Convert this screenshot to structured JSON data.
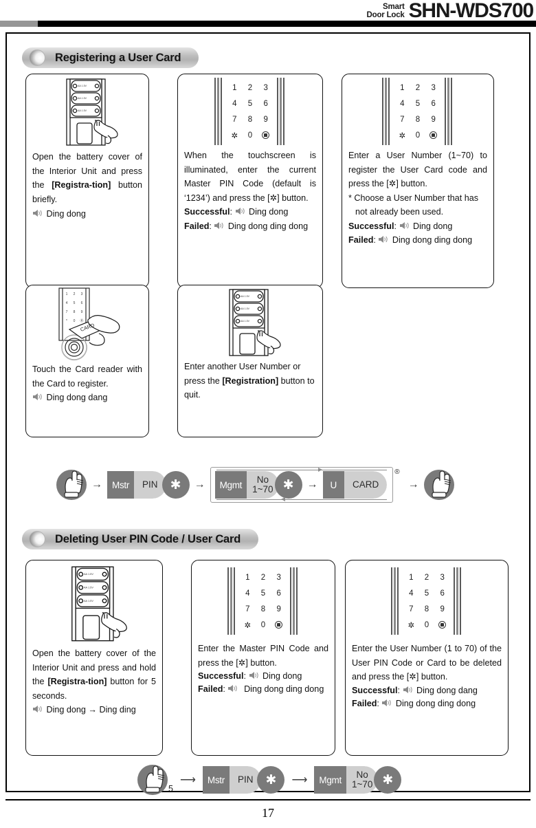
{
  "header": {
    "brand_line1": "Smart",
    "brand_line2": "Door Lock",
    "model": "SHN-WDS700"
  },
  "sections": [
    {
      "title": "Registering a User Card",
      "cards": [
        {
          "art": "battery-cover-press",
          "lines": [
            {
              "t": "Open the battery cover of the Interior Unit and press the ",
              "b": "[Registra-tion]",
              "t2": " button briefly."
            }
          ],
          "sound": "Ding dong"
        },
        {
          "art": "keypad",
          "body": "When the touchscreen is illuminated, enter the current Master PIN Code (default is ‘1234’) and press the [✲] button.",
          "success_label": "Successful",
          "success_sound": "Ding dong",
          "failed_label": "Failed",
          "failed_sound": "Ding dong ding dong"
        },
        {
          "art": "keypad",
          "body": "Enter a User Number (1~70) to register the User Card code and press the [✲] button.",
          "note": "* Choose a User Number that has not already been used.",
          "success_label": "Successful",
          "success_sound": "Ding dong",
          "failed_label": "Failed",
          "failed_sound": "Ding dong ding dong"
        },
        {
          "art": "card-reader",
          "body": "Touch the Card reader with the Card to register.",
          "sound": "Ding dong dang"
        },
        {
          "art": "battery-cover-press",
          "body_pre": "Enter another User Number or press the ",
          "body_bold": "[Registration]",
          "body_post": " button  to quit."
        }
      ],
      "flow": {
        "hand": "hand-press-icon",
        "arrow": "→",
        "steps": [
          {
            "left": "Mstr",
            "right": "PIN"
          },
          {
            "star": "✱"
          },
          {
            "group": [
              {
                "left": "Mgmt",
                "right": "No\n1~70"
              },
              {
                "star": "✱"
              },
              {
                "arrow": "→"
              },
              {
                "left": "U",
                "right": "CARD"
              }
            ],
            "reg": "®"
          },
          {
            "hand": "hand-press-icon"
          }
        ]
      }
    },
    {
      "title": "Deleting User PIN Code / User Card",
      "cards": [
        {
          "art": "battery-cover-press",
          "body_pre": "Open the battery cover of the Interior Unit and press and hold the ",
          "body_bold": "[Registra-tion]",
          "body_post": " button for 5 seconds.",
          "sound": "Ding dong → Ding ding"
        },
        {
          "art": "keypad",
          "body": "Enter the Master PIN Code and press the [✲] button.",
          "success_label": "Successful",
          "success_sound": "Ding dong",
          "failed_label": "Failed",
          "failed_sound": "Ding dong ding dong"
        },
        {
          "art": "keypad",
          "body": "Enter the User Number (1 to 70) of the User PIN Code or Card to be deleted and press the [✲] button.",
          "success_label": "Successful",
          "success_sound": "Ding dong dang",
          "failed_label": "Failed",
          "failed_sound": "Ding dong ding dong"
        }
      ],
      "flow": {
        "hold_seconds": "5",
        "steps": [
          {
            "left": "Mstr",
            "right": "PIN"
          },
          {
            "star": "✱"
          },
          {
            "left": "Mgmt",
            "right": "No\n1~70"
          },
          {
            "star": "✱"
          }
        ]
      }
    }
  ],
  "keypad": {
    "keys": [
      "1",
      "2",
      "3",
      "4",
      "5",
      "6",
      "7",
      "8",
      "9",
      "✲",
      "0",
      "lock-icon"
    ]
  },
  "footer": {
    "page_number": "17"
  },
  "colors": {
    "accent_dark": "#7a7a7a",
    "accent_light": "#cfcfcf",
    "rule": "#000000"
  }
}
